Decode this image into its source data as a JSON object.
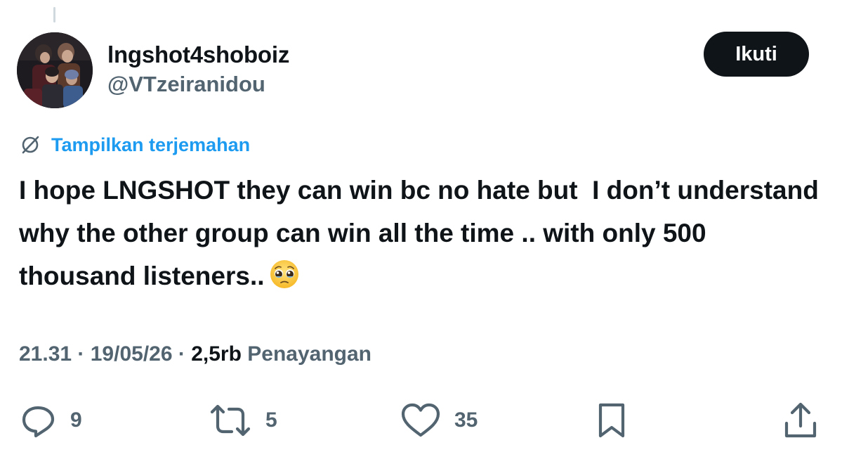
{
  "author": {
    "display_name": "lngshot4shoboiz",
    "handle": "@VTzeiranidou"
  },
  "follow_button": {
    "label": "Ikuti"
  },
  "translate": {
    "label": "Tampilkan terjemahan"
  },
  "tweet": {
    "text": "I hope LNGSHOT they can win bc no hate but  I don’t understand why the other group can win all the time .. with only 500 thousand listeners.."
  },
  "meta": {
    "time": "21.31",
    "separator": " · ",
    "date": "19/05/26",
    "views_count": "2,5rb",
    "views_label": " Penayangan"
  },
  "actions": {
    "replies": "9",
    "reposts": "5",
    "likes": "35"
  },
  "colors": {
    "text_primary": "#0f1419",
    "text_secondary": "#536471",
    "link": "#1d9bf0",
    "button_bg": "#0f1419"
  },
  "icons": {
    "reply": "reply-icon",
    "repost": "repost-icon",
    "like": "heart-icon",
    "bookmark": "bookmark-icon",
    "share": "share-icon",
    "translate": "translate-icon",
    "emoji": "pleading-face-emoji"
  }
}
